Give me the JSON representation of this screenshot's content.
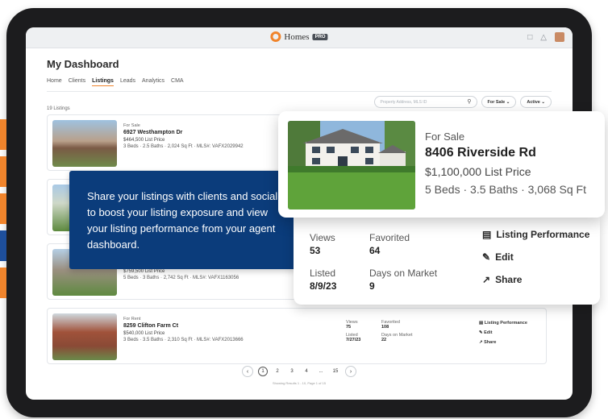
{
  "app": {
    "brand": "Homes",
    "brand_badge": "PRO"
  },
  "header": {
    "title": "My Dashboard",
    "tabs": [
      "Home",
      "Clients",
      "Listings",
      "Leads",
      "Analytics",
      "CMA"
    ],
    "active_tab": "Listings"
  },
  "toolbar": {
    "listing_count": "19 Listings",
    "search_placeholder": "Property Address, MLS ID",
    "status_filter": "For Sale",
    "active_filter": "Active"
  },
  "listings": [
    {
      "status": "For Sale",
      "address": "6927 Westhampton Dr",
      "price": "$464,500 List Price",
      "specs": "3 Beds · 2.5 Baths · 2,024 Sq Ft · MLS#: VAFX2029942"
    },
    {
      "status": "",
      "address": "",
      "price": "",
      "specs": ""
    },
    {
      "status": "",
      "address": "",
      "price": "$759,500 List Price",
      "specs": "5 Beds · 3 Baths · 2,742 Sq Ft · MLS#: VAFX1163056"
    },
    {
      "status": "For Rent",
      "address": "8259 Clifton Farm Ct",
      "price": "$540,000 List Price",
      "specs": "3 Beds · 3.5 Baths · 2,310 Sq Ft · MLS#: VAFX2013666",
      "views_label": "Views",
      "views": "75",
      "fav_label": "Favorited",
      "fav": "108",
      "listed_label": "Listed",
      "listed": "7/27/23",
      "dom_label": "Days on Market",
      "dom": "22"
    }
  ],
  "card_actions": {
    "performance": "Listing Performance",
    "edit": "Edit",
    "share": "Share"
  },
  "promo": {
    "text": "Share your listings with clients and social to boost your listing exposure and view your listing performance from your agent dashboard."
  },
  "featured": {
    "status": "For Sale",
    "address": "8406 Riverside Rd",
    "price": "$1,100,000 List Price",
    "specs": "5 Beds · 3.5 Baths · 3,068 Sq Ft",
    "views_label": "Views",
    "views": "53",
    "fav_label": "Favorited",
    "fav": "64",
    "listed_label": "Listed",
    "listed": "8/9/23",
    "dom_label": "Days on Market",
    "dom": "9",
    "actions": {
      "performance": "Listing Performance",
      "edit": "Edit",
      "share": "Share"
    }
  },
  "pagination": {
    "pages": [
      "1",
      "2",
      "3",
      "4",
      "...",
      "15"
    ],
    "active": "1",
    "caption": "Showing Results 1 - 10, Page 1 of 15"
  },
  "colors": {
    "accent": "#f0842c",
    "promo_bg": "#0b3c7b",
    "device": "#1c1c1e"
  }
}
